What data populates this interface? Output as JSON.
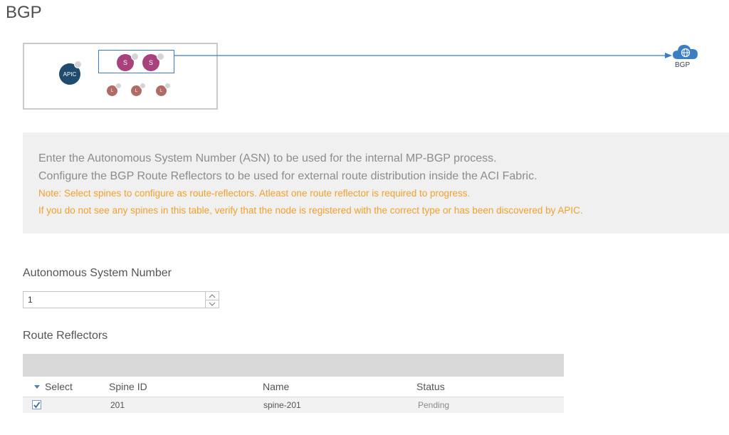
{
  "page": {
    "title": "BGP"
  },
  "topology": {
    "apic_label": "APIC",
    "spine_label": "S",
    "leaf_label": "L",
    "external_label": "BGP",
    "colors": {
      "apic": "#1f4b6e",
      "spine": "#a8427c",
      "leaf": "#b06b65",
      "link": "#3a7fc4"
    }
  },
  "info": {
    "line1": "Enter the Autonomous System Number (ASN) to be used for the internal MP-BGP process.",
    "line2": "Configure the BGP Route Reflectors to be used for external route distribution inside the ACI Fabric.",
    "note1": "Note: Select spines to configure as route-reflectors. Atleast one route reflector is required to progress.",
    "note2": "If you do not see any spines in this table, verify that the node is registered with the correct type or has been discovered by APIC."
  },
  "asn": {
    "label": "Autonomous System Number",
    "value": "1"
  },
  "route_reflectors": {
    "label": "Route Reflectors",
    "columns": {
      "select": "Select",
      "spine_id": "Spine ID",
      "name": "Name",
      "status": "Status"
    },
    "rows": [
      {
        "selected": true,
        "spine_id": "201",
        "name": "spine-201",
        "status": "Pending"
      }
    ]
  }
}
